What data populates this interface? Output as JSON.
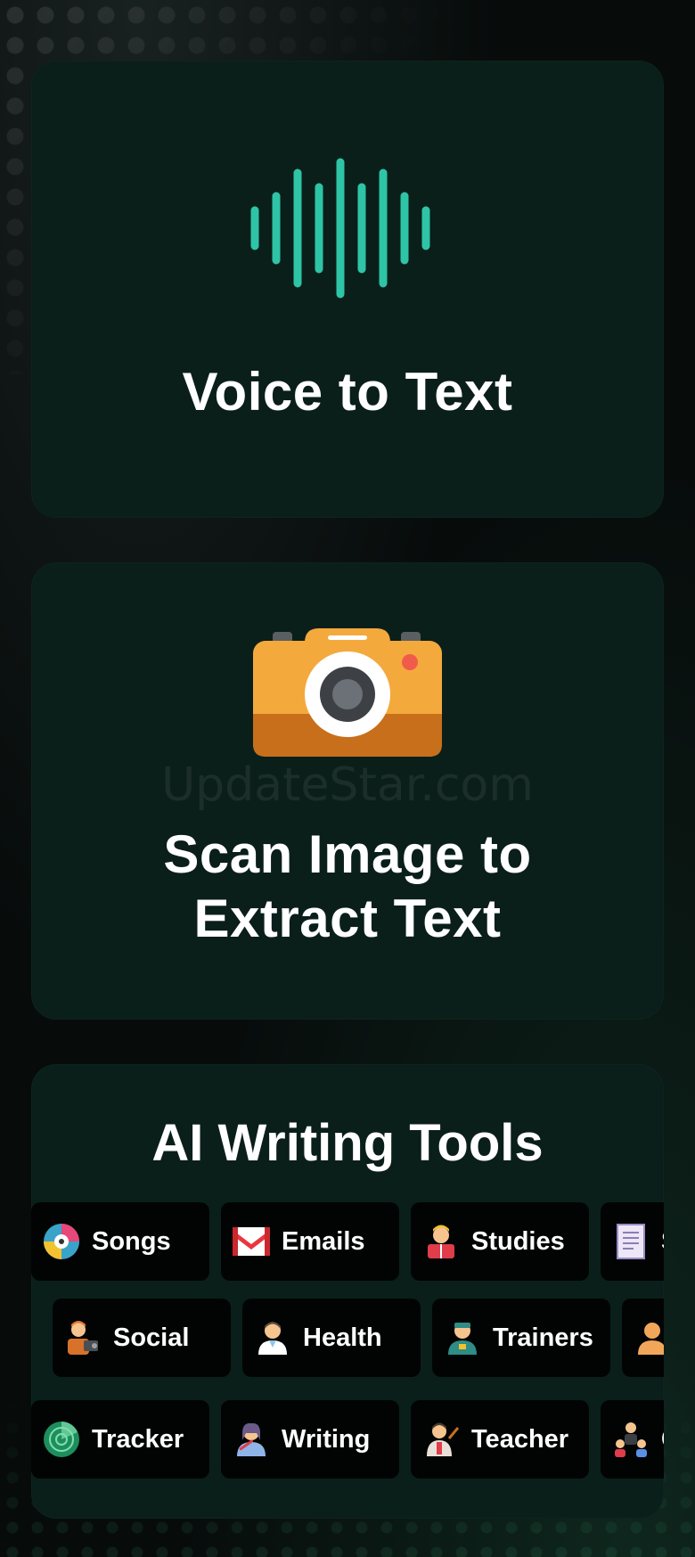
{
  "features": {
    "voice": {
      "title": "Voice to Text",
      "icon": "sound-wave-icon",
      "accent": "#2ec4a6"
    },
    "scan": {
      "title": "Scan Image to\nExtract Text",
      "icon": "camera-icon",
      "watermark": "UpdateStar.com"
    },
    "tools": {
      "title": "AI Writing Tools",
      "rows": [
        [
          {
            "label": "Songs",
            "icon": "music-disc-icon"
          },
          {
            "label": "Emails",
            "icon": "mail-icon"
          },
          {
            "label": "Studies",
            "icon": "student-reading-icon"
          },
          {
            "label": "S",
            "icon": "script-document-icon"
          }
        ],
        [
          {
            "label": "",
            "icon": "partial-icon"
          },
          {
            "label": "Social",
            "icon": "videographer-icon"
          },
          {
            "label": "Health",
            "icon": "doctor-icon"
          },
          {
            "label": "Trainers",
            "icon": "trainer-icon"
          },
          {
            "label": "",
            "icon": "person-icon"
          }
        ],
        [
          {
            "label": "Tracker",
            "icon": "radar-icon"
          },
          {
            "label": "Writing",
            "icon": "writer-icon"
          },
          {
            "label": "Teacher",
            "icon": "teacher-icon"
          },
          {
            "label": "Co",
            "icon": "team-icon"
          }
        ]
      ]
    }
  }
}
